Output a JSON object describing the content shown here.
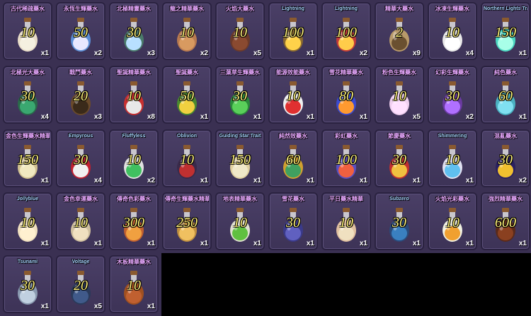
{
  "inventory": {
    "items": [
      {
        "name": "古代稀疏藥水",
        "power": "10",
        "count": "x1",
        "glass": "#e8dcc8",
        "liquid": "#f5f0e0",
        "lang": "zh"
      },
      {
        "name": "永恆生輝藥水",
        "power": "50",
        "count": "x2",
        "glass": "#5c8fd6",
        "liquid": "#e8e8ff",
        "lang": "zh"
      },
      {
        "name": "北極精靈藥水",
        "power": "30",
        "count": "x3",
        "glass": "#4a7a6a",
        "liquid": "#b8e0ff",
        "lang": "zh"
      },
      {
        "name": "龍之精華藥水",
        "power": "10",
        "count": "x2",
        "glass": "#b87a50",
        "liquid": "#d89a60",
        "lang": "zh"
      },
      {
        "name": "火焰大藥水",
        "power": "10",
        "count": "x5",
        "glass": "#6b3a2a",
        "liquid": "#8a4a30",
        "lang": "zh"
      },
      {
        "name": "Lightning",
        "power": "100",
        "count": "x1",
        "glass": "#8a6a30",
        "liquid": "#ffd24a",
        "lang": "en"
      },
      {
        "name": "Lightning",
        "power": "100",
        "count": "x2",
        "glass": "#c23a3a",
        "liquid": "#ffcc4a",
        "lang": "en"
      },
      {
        "name": "精華大藥水",
        "power": "2",
        "count": "x9",
        "glass": "#b89a6a",
        "liquid": "#6a5030",
        "lang": "zh"
      },
      {
        "name": "冰凍生輝藥水",
        "power": "10",
        "count": "x4",
        "glass": "#e8e8e8",
        "liquid": "#ffffff",
        "lang": "zh"
      },
      {
        "name": "Northern Lights Trait",
        "power": "150",
        "count": "x1",
        "glass": "#4ad6c0",
        "liquid": "#a8ffe8",
        "lang": "en"
      },
      {
        "name": "北極光大藥水",
        "power": "30",
        "count": "x4",
        "glass": "#2a6a4a",
        "liquid": "#3aa870",
        "lang": "zh"
      },
      {
        "name": "戰鬥藥水",
        "power": "20",
        "count": "x3",
        "glass": "#6a4a2a",
        "liquid": "#3a2a1a",
        "lang": "zh"
      },
      {
        "name": "聖誕精華藥水",
        "power": "10",
        "count": "x8",
        "glass": "#c83030",
        "liquid": "#e8e8e8",
        "lang": "zh"
      },
      {
        "name": "聖誕藥水",
        "power": "50",
        "count": "x1",
        "glass": "#4a8a30",
        "liquid": "#f0d040",
        "lang": "zh"
      },
      {
        "name": "三葉草生輝藥水",
        "power": "30",
        "count": "x1",
        "glass": "#2a8a3a",
        "liquid": "#5ad05a",
        "lang": "zh"
      },
      {
        "name": "能源效能藥水",
        "power": "10",
        "count": "x1",
        "glass": "#f0f0f0",
        "liquid": "#e03030",
        "lang": "zh"
      },
      {
        "name": "雪花精華藥水",
        "power": "80",
        "count": "x1",
        "glass": "#3a4ad0",
        "liquid": "#ff9a30",
        "lang": "zh"
      },
      {
        "name": "粉色生輝藥水",
        "power": "10",
        "count": "x5",
        "glass": "#f0d0f0",
        "liquid": "#ffe0ff",
        "lang": "zh"
      },
      {
        "name": "幻彩生輝藥水",
        "power": "30",
        "count": "x2",
        "glass": "#6a3aa0",
        "liquid": "#b070ff",
        "lang": "zh"
      },
      {
        "name": "純色藥水",
        "power": "60",
        "count": "x1",
        "glass": "#4ab0c0",
        "liquid": "#80e0f0",
        "lang": "zh"
      },
      {
        "name": "金色生輝藥水精華",
        "power": "150",
        "count": "x1",
        "glass": "#d0c090",
        "liquid": "#f0e8c0",
        "lang": "zh"
      },
      {
        "name": "Empyrous",
        "power": "30",
        "count": "x4",
        "glass": "#c02030",
        "liquid": "#f0f0f0",
        "lang": "en"
      },
      {
        "name": "Fluffyless",
        "power": "10",
        "count": "x2",
        "glass": "#e0e0e0",
        "liquid": "#40c060",
        "lang": "en"
      },
      {
        "name": "Oblivion",
        "power": "10",
        "count": "x1",
        "glass": "#3a2a4a",
        "liquid": "#c03030",
        "lang": "en"
      },
      {
        "name": "Guiding Star Trait",
        "power": "150",
        "count": "x1",
        "glass": "#e0d0a0",
        "liquid": "#f0e8c8",
        "lang": "en"
      },
      {
        "name": "純然效藥水",
        "power": "60",
        "count": "x1",
        "glass": "#d0a030",
        "liquid": "#40a060",
        "lang": "zh"
      },
      {
        "name": "彩虹藥水",
        "power": "100",
        "count": "x1",
        "glass": "#5a50c0",
        "liquid": "#f06040",
        "lang": "zh"
      },
      {
        "name": "節慶藥水",
        "power": "30",
        "count": "x1",
        "glass": "#c03030",
        "liquid": "#f0c040",
        "lang": "zh"
      },
      {
        "name": "Shimmering",
        "power": "10",
        "count": "x1",
        "glass": "#e0e0f0",
        "liquid": "#60c0f0",
        "lang": "en"
      },
      {
        "name": "混亂藥水",
        "power": "30",
        "count": "x2",
        "glass": "#2a2060",
        "liquid": "#f0c030",
        "lang": "zh"
      },
      {
        "name": "Jollyblue",
        "power": "10",
        "count": "x1",
        "glass": "#f0e0c0",
        "liquid": "#fff0d0",
        "lang": "en"
      },
      {
        "name": "金色幸運藥水",
        "power": "10",
        "count": "x1",
        "glass": "#d0c0a0",
        "liquid": "#f0e0c0",
        "lang": "zh"
      },
      {
        "name": "傳奇色彩藥水",
        "power": "300",
        "count": "x1",
        "glass": "#c06030",
        "liquid": "#f0a040",
        "lang": "zh"
      },
      {
        "name": "傳奇生輝藥水精華",
        "power": "250",
        "count": "x1",
        "glass": "#c09040",
        "liquid": "#f0c060",
        "lang": "zh"
      },
      {
        "name": "地表精華藥水",
        "power": "10",
        "count": "x1",
        "glass": "#e0e0d0",
        "liquid": "#60c040",
        "lang": "zh"
      },
      {
        "name": "雪花藥水",
        "power": "30",
        "count": "x1",
        "glass": "#3a3a8a",
        "liquid": "#6060c0",
        "lang": "zh"
      },
      {
        "name": "平日藥水精華",
        "power": "10",
        "count": "x1",
        "glass": "#e0c0a0",
        "liquid": "#f0e0c0",
        "lang": "zh"
      },
      {
        "name": "Subzero",
        "power": "30",
        "count": "x1",
        "glass": "#2a4a7a",
        "liquid": "#3a80c0",
        "lang": "en"
      },
      {
        "name": "火焰光彩藥水",
        "power": "10",
        "count": "x1",
        "glass": "#f0f0e0",
        "liquid": "#f0a030",
        "lang": "zh"
      },
      {
        "name": "強烈精華藥水",
        "power": "600",
        "count": "x1",
        "glass": "#5a2a1a",
        "liquid": "#8a4020",
        "lang": "zh"
      },
      {
        "name": "Tsunami",
        "power": "30",
        "count": "x1",
        "glass": "#8a9ab0",
        "liquid": "#c0d0e0",
        "lang": "en"
      },
      {
        "name": "Voltage",
        "power": "20",
        "count": "x5",
        "glass": "#2a3a5a",
        "liquid": "#405a8a",
        "lang": "en"
      },
      {
        "name": "木板精華藥水",
        "power": "10",
        "count": "x1",
        "glass": "#a05020",
        "liquid": "#c06030",
        "lang": "zh"
      }
    ]
  }
}
